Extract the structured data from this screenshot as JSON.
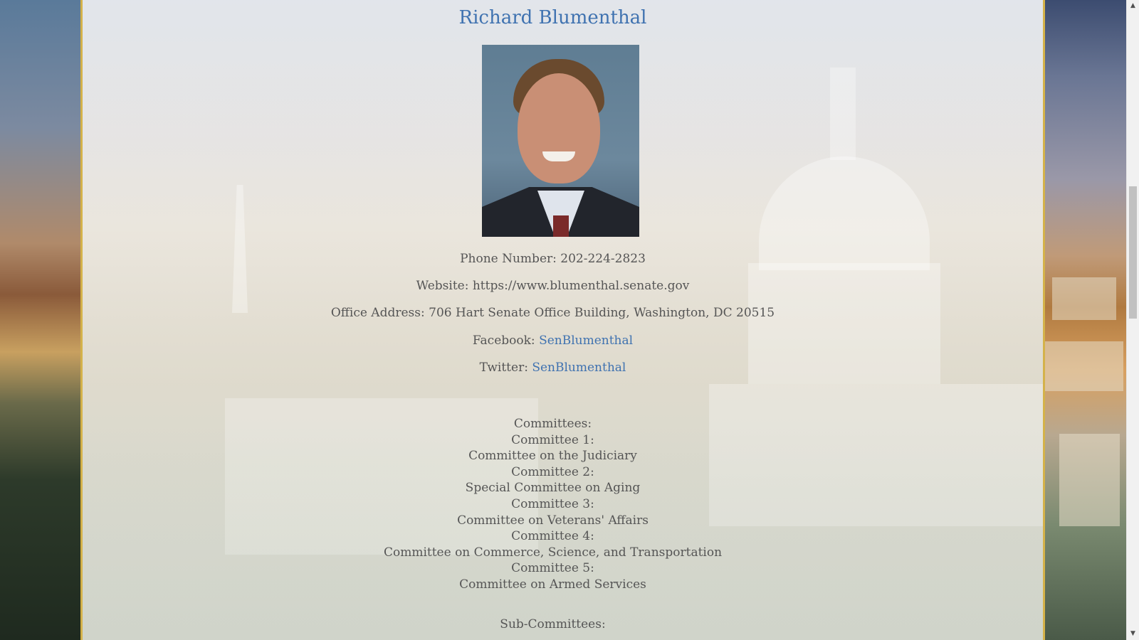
{
  "senator": {
    "name": "Richard Blumenthal",
    "photo_alt": "Richard Blumenthal portrait"
  },
  "contact": {
    "phone_label": "Phone Number:",
    "phone_value": "202-224-2823",
    "website_label": "Website:",
    "website_value": "https://www.blumenthal.senate.gov",
    "office_label": "Office Address:",
    "office_value": "706 Hart Senate Office Building, Washington, DC 20515",
    "facebook_label": "Facebook:",
    "facebook_value": "SenBlumenthal",
    "twitter_label": "Twitter:",
    "twitter_value": "SenBlumenthal"
  },
  "committees": {
    "heading": "Committees:",
    "items": [
      {
        "label": "Committee 1:",
        "name": "Committee on the Judiciary"
      },
      {
        "label": "Committee 2:",
        "name": "Special Committee on Aging"
      },
      {
        "label": "Committee 3:",
        "name": "Committee on Veterans' Affairs"
      },
      {
        "label": "Committee 4:",
        "name": "Committee on Commerce, Science, and Transportation"
      },
      {
        "label": "Committee 5:",
        "name": "Committee on Armed Services"
      }
    ]
  },
  "sub_committees": {
    "heading": "Sub-Committees:"
  },
  "scrollbar": {
    "up_glyph": "▲",
    "down_glyph": "▼"
  },
  "colors": {
    "link": "#3f72b0",
    "text": "#555555",
    "border_gold": "#d4b24a"
  }
}
